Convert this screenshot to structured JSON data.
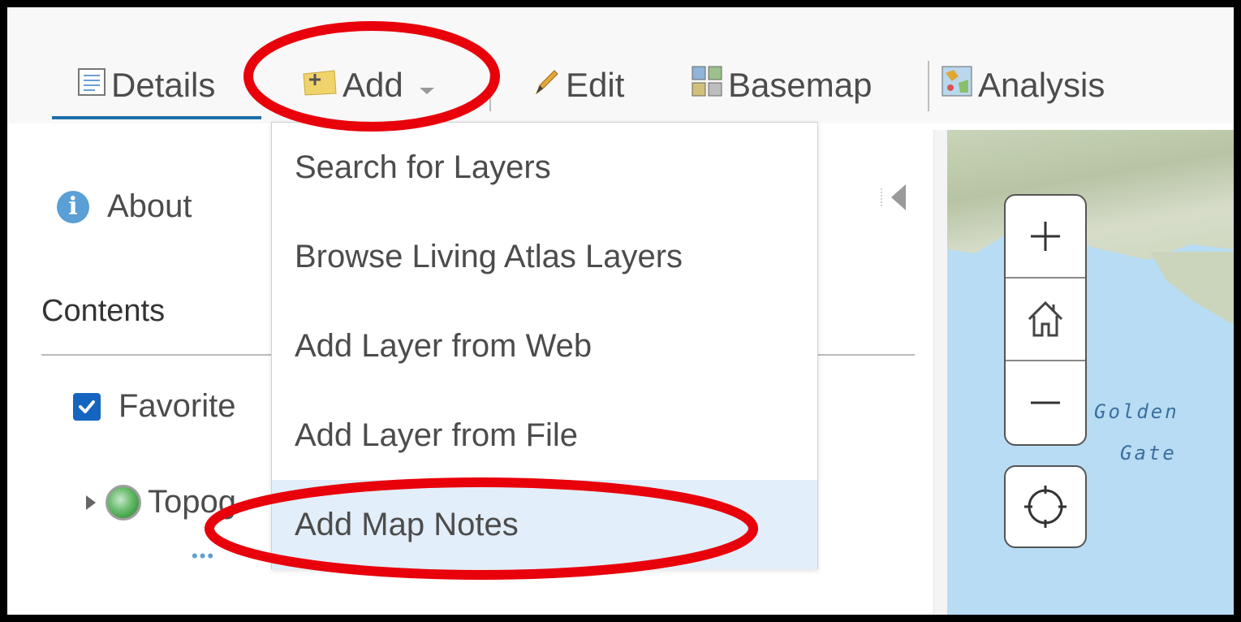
{
  "toolbar": {
    "details_label": "Details",
    "add_label": "Add",
    "edit_label": "Edit",
    "basemap_label": "Basemap",
    "analysis_label": "Analysis"
  },
  "left_panel": {
    "about_label": "About",
    "contents_title": "Contents",
    "layer_label": "Favorite",
    "sublayer_label": "Topog",
    "more_dots": "•••"
  },
  "add_menu": {
    "items": [
      {
        "label": "Search for Layers"
      },
      {
        "label": "Browse Living Atlas Layers"
      },
      {
        "label": "Add Layer from Web"
      },
      {
        "label": "Add Layer from File"
      },
      {
        "label": "Add Map Notes",
        "highlighted": true
      }
    ]
  },
  "map": {
    "label_line1": "Golden",
    "label_line2": "Gate",
    "controls": [
      "zoom-in",
      "home",
      "zoom-out",
      "locate"
    ]
  },
  "colors": {
    "accent": "#1f6fa8",
    "annotation": "#e8000b",
    "menu_highlight": "#e2eefa",
    "water": "#b7dcf3"
  }
}
